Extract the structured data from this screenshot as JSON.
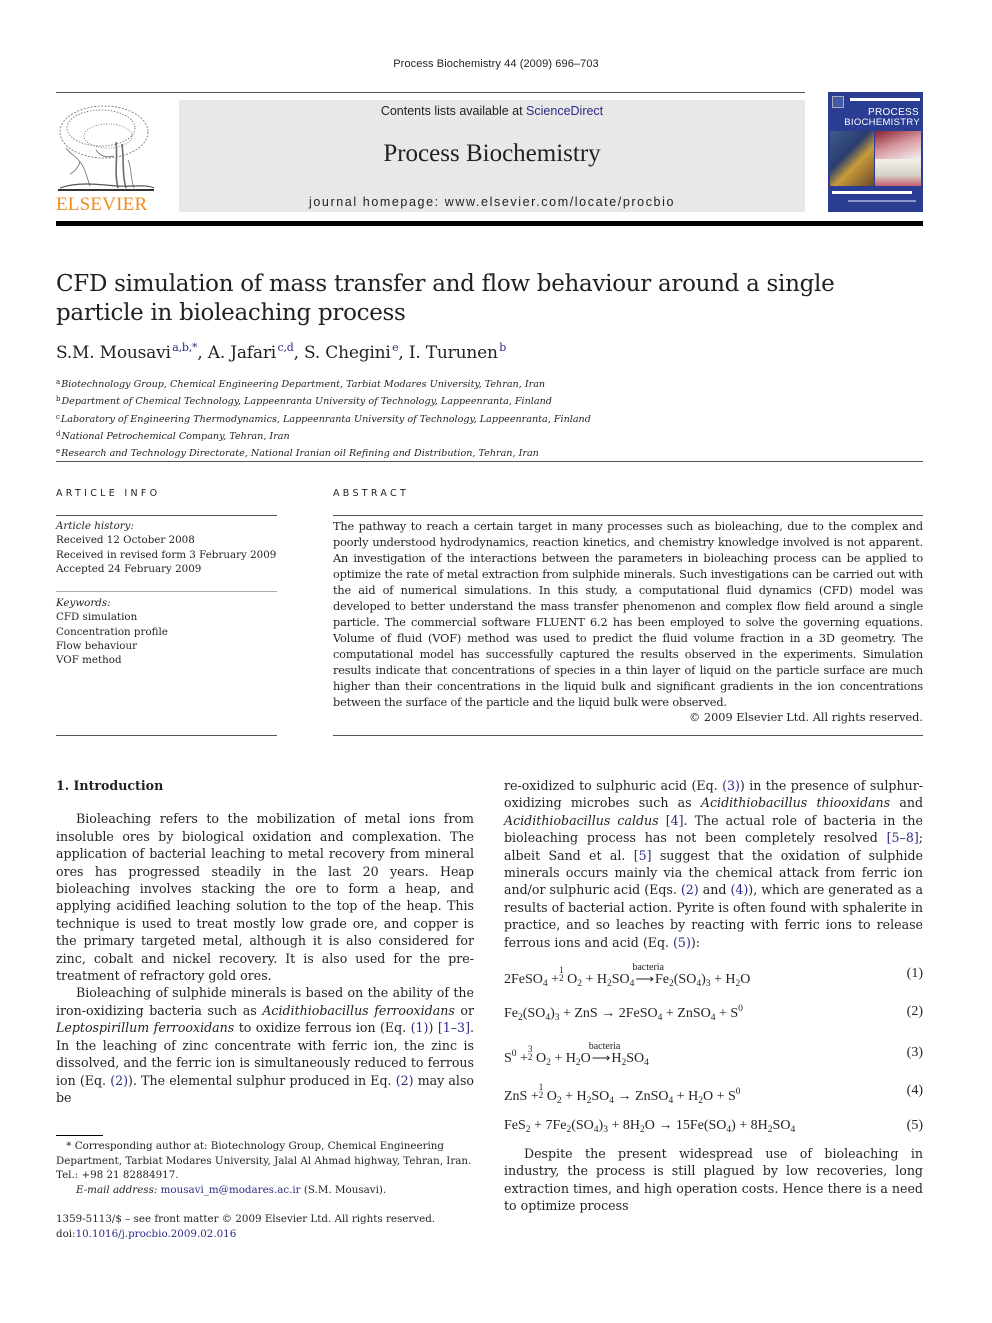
{
  "header": {
    "journal_ref": "Process Biochemistry 44 (2009) 696–703",
    "contents_prefix": "Contents lists available at ",
    "contents_link": "ScienceDirect",
    "journal_name": "Process Biochemistry",
    "homepage": "journal homepage: www.elsevier.com/locate/procbio",
    "publisher_logo_text": "ELSEVIER",
    "cover_title_line1": "PROCESS",
    "cover_title_line2": "BIOCHEMISTRY",
    "colors": {
      "elsevier_orange": "#f08c1e",
      "link_blue": "#2a2a86",
      "cover_blue": "#2b3d93",
      "masthead_gray": "#e8e8e8"
    }
  },
  "article": {
    "title": "CFD simulation of mass transfer and flow behaviour around a single particle in bioleaching process",
    "authors": [
      {
        "name": "S.M. Mousavi",
        "affil": "a,b,*"
      },
      {
        "name": "A. Jafari",
        "affil": "c,d"
      },
      {
        "name": "S. Chegini",
        "affil": "e"
      },
      {
        "name": "I. Turunen",
        "affil": "b"
      }
    ],
    "affiliations": [
      {
        "key": "a",
        "text": "Biotechnology Group, Chemical Engineering Department, Tarbiat Modares University, Tehran, Iran"
      },
      {
        "key": "b",
        "text": "Department of Chemical Technology, Lappeenranta University of Technology, Lappeenranta, Finland"
      },
      {
        "key": "c",
        "text": "Laboratory of Engineering Thermodynamics, Lappeenranta University of Technology, Lappeenranta, Finland"
      },
      {
        "key": "d",
        "text": "National Petrochemical Company, Tehran, Iran"
      },
      {
        "key": "e",
        "text": "Research and Technology Directorate, National Iranian oil Refining and Distribution, Tehran, Iran"
      }
    ]
  },
  "article_info": {
    "heading": "ARTICLE INFO",
    "history_label": "Article history:",
    "history": [
      "Received 12 October 2008",
      "Received in revised form 3 February 2009",
      "Accepted 24 February 2009"
    ],
    "keywords_label": "Keywords:",
    "keywords": [
      "CFD simulation",
      "Concentration profile",
      "Flow behaviour",
      "VOF method"
    ]
  },
  "abstract": {
    "heading": "ABSTRACT",
    "text": "The pathway to reach a certain target in many processes such as bioleaching, due to the complex and poorly understood hydrodynamics, reaction kinetics, and chemistry knowledge involved is not apparent. An investigation of the interactions between the parameters in bioleaching process can be applied to optimize the rate of metal extraction from sulphide minerals. Such investigations can be carried out with the aid of numerical simulations. In this study, a computational fluid dynamics (CFD) model was developed to better understand the mass transfer phenomenon and complex flow field around a single particle. The commercial software FLUENT 6.2 has been employed to solve the governing equations. Volume of fluid (VOF) method was used to predict the fluid volume fraction in a 3D geometry. The computational model has successfully captured the results observed in the experiments. Simulation results indicate that concentrations of species in a thin layer of liquid on the particle surface are much higher than their concentrations in the liquid bulk and significant gradients in the ion concentrations between the surface of the particle and the liquid bulk were observed.",
    "copyright": "© 2009 Elsevier Ltd. All rights reserved."
  },
  "body": {
    "intro_heading": "1.  Introduction",
    "p1": "Bioleaching refers to the mobilization of metal ions from insoluble ores by biological oxidation and complexation. The application of bacterial leaching to metal recovery from mineral ores has progressed steadily in the last 20 years. Heap bioleaching involves stacking the ore to form a heap, and applying acidified leaching solution to the top of the heap. This technique is used to treat mostly low grade ore, and copper is the primary targeted metal, although it is also considered for zinc, cobalt and nickel recovery. It is also used for the pre-treatment of refractory gold ores.",
    "p2_a": "Bioleaching of sulphide minerals is based on the ability of the iron-oxidizing bacteria such as ",
    "p2_sp1": "Acidithiobacillus ferrooxidans",
    "p2_b": " or ",
    "p2_sp2": "Leptospirillum ferrooxidans",
    "p2_c": " to oxidize ferrous ion (Eq. ",
    "p2_ref_eq1": "(1)",
    "p2_d": ") ",
    "p2_ref_cite": "[1–3]",
    "p2_e": ". In the leaching of zinc concentrate with ferric ion, the zinc is dissolved, and the ferric ion is simultaneously reduced to ferrous ion (Eq. ",
    "p2_ref_eq2a": "(2)",
    "p2_f": "). The elemental sulphur produced in Eq. ",
    "p2_ref_eq2b": "(2)",
    "p2_g": " may also be",
    "p3_a": "re-oxidized to sulphuric acid (Eq. ",
    "p3_ref_eq3": "(3)",
    "p3_b": ") in the presence of sulphur-oxidizing microbes such as ",
    "p3_sp1": "Acidithiobacillus thiooxidans",
    "p3_c": " and ",
    "p3_sp2": "Acidithiobacillus caldus",
    "p3_d": " ",
    "p3_ref4": "[4]",
    "p3_e": ". The actual role of bacteria in the bioleaching process has not been completely resolved ",
    "p3_ref58": "[5–8]",
    "p3_f": "; albeit Sand et al. ",
    "p3_ref5": "[5]",
    "p3_g": " suggest that the oxidation of sulphide minerals occurs mainly via the chemical attack from ferric ion and/or sulphuric acid (Eqs. ",
    "p3_ref_eq2": "(2)",
    "p3_h": " and ",
    "p3_ref_eq4": "(4)",
    "p3_i": "), which are generated as a results of bacterial action. Pyrite is often found with sphalerite in practice, and so leaches by reacting with ferric ions to release ferrous ions and acid (Eq. ",
    "p3_ref_eq5": "(5)",
    "p3_j": "):",
    "p4": "Despite the present widespread use of bioleaching in industry, the process is still plagued by low recoveries, long extraction times, and high operation costs. Hence there is a need to optimize process"
  },
  "equations": [
    {
      "number": "(1)",
      "arrow_label": "bacteria"
    },
    {
      "number": "(2)"
    },
    {
      "number": "(3)",
      "arrow_label": "bacteria"
    },
    {
      "number": "(4)"
    },
    {
      "number": "(5)"
    }
  ],
  "footnote": {
    "marker": "*",
    "corresponding": "Corresponding author at: Biotechnology Group, Chemical Engineering Department, Tarbiat Modares University, Jalal Al Ahmad highway, Tehran, Iran.",
    "tel": "Tel.: +98 21 82884917.",
    "email_label": "E-mail address:",
    "email": "mousavi_m@modares.ac.ir",
    "email_owner": " (S.M. Mousavi).",
    "issn": "1359-5113/$ – see front matter © 2009 Elsevier Ltd. All rights reserved.",
    "doi_prefix": "doi:",
    "doi": "10.1016/j.procbio.2009.02.016"
  }
}
